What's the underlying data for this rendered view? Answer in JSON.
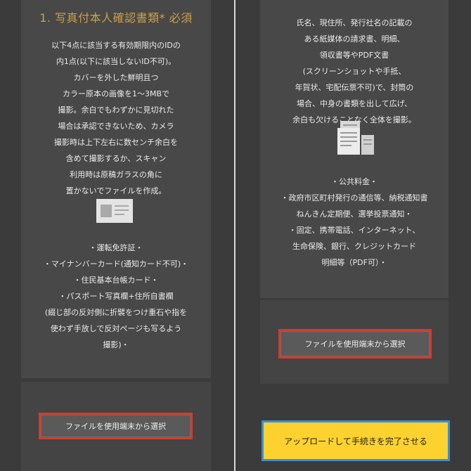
{
  "left": {
    "title": "1. 写真付本人確認書類* 必須",
    "description_lines": [
      "以下4点に該当する有効期限内のIDの",
      "内1点(以下に該当しないID不可)。",
      "カバーを外した鮮明且つ",
      "カラー原本の画像を1～3MBで",
      "撮影。余白でもわずかに見切れた",
      "場合は承認できないため、カメラ",
      "撮影時は上下左右に数センチ余白を",
      "含めて撮影するか、スキャン",
      "利用時は原稿ガラスの角に",
      "置かないでファイルを作成。"
    ],
    "id_list_lines": [
      "・運転免許証・",
      "・マイナンバーカード(通知カード不可)・",
      "・住民基本台帳カード・",
      "・パスポート写真欄+住所自書欄",
      "(綴じ部の反対側に折襞をつけ重石や指を",
      "使わず手放しで反対ページも写るよう",
      "撮影)・"
    ],
    "icon": "id-card-icon",
    "file_button_label": "ファイルを使用端末から選択"
  },
  "right": {
    "description_lines": [
      "氏名、現住所、発行社名の記載の",
      "ある紙媒体の請求書、明細、",
      "領収書等やPDF文書",
      "(スクリーンショットや手抵、",
      "年賀状、宅配伝票不可)で、封筒の",
      "場合、中身の書類を出して広げ、",
      "余白も欠けることなく全体を撮影。"
    ],
    "icon": "documents-icon",
    "list_lines": [
      "・公共料金・",
      "・政府市区町村発行の通信等、納税通知書",
      "ねんきん定期便、選挙投票通知・",
      "・固定、携帯電話、インターネット、",
      "生命保険、銀行、クレジットカード",
      "明細等（PDF可）・"
    ],
    "file_button_label": "ファイルを使用端末から選択",
    "submit_button_label": "アップロードして手続きを完了させる"
  },
  "colors": {
    "accent_gold": "#c8a04a",
    "highlight_red": "#d53a2b",
    "submit_yellow": "#fdd22e",
    "submit_border_blue": "#3b8fd6"
  }
}
